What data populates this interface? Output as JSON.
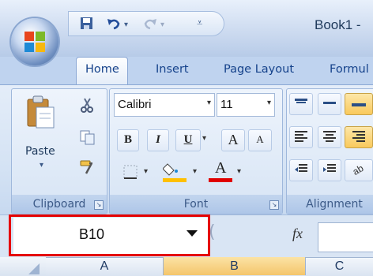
{
  "window": {
    "title": "Book1 -",
    "qat_icons": [
      "save-icon",
      "undo-icon",
      "redo-icon",
      "customize-icon"
    ]
  },
  "tabs": [
    {
      "label": "Home",
      "active": true
    },
    {
      "label": "Insert"
    },
    {
      "label": "Page Layout"
    },
    {
      "label": "Formul"
    }
  ],
  "clipboard": {
    "paste_label": "Paste",
    "group_label": "Clipboard"
  },
  "font": {
    "name_value": "Calibri",
    "size_value": "11",
    "bold": "B",
    "italic": "I",
    "underline": "U",
    "grow": "A",
    "shrink": "A",
    "font_color_letter": "A",
    "group_label": "Font",
    "fill_color": "#ffc000",
    "font_color": "#e00000"
  },
  "alignment": {
    "group_label": "Alignment"
  },
  "formula_bar": {
    "namebox_value": "B10",
    "fx_label": "fx",
    "highlight_color": "#e50000"
  },
  "columns": [
    {
      "label": "A"
    },
    {
      "label": "B",
      "selected": true
    },
    {
      "label": "C"
    }
  ]
}
